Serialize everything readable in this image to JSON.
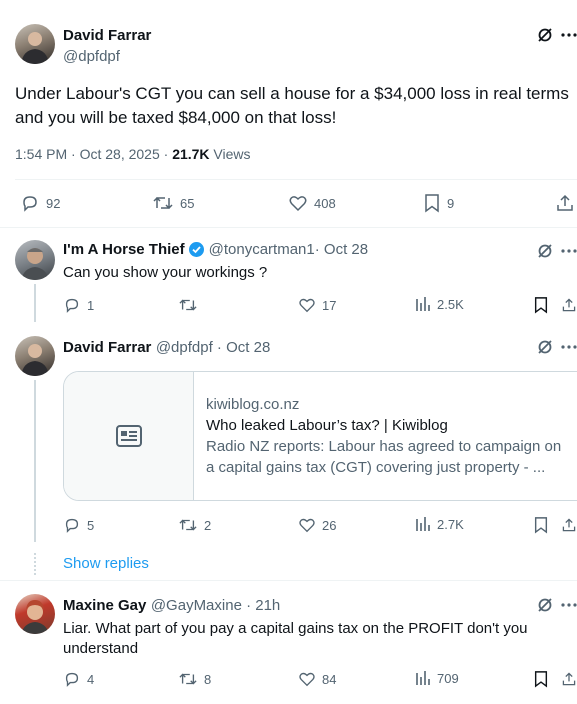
{
  "main_post": {
    "author_name": "David Farrar",
    "author_handle": "@dpfdpf",
    "text_line1": "Under Labour's CGT you can sell a house for a $34,000 loss in real terms",
    "text_line2": "and you will be taxed $84,000 on that loss!",
    "time": "1:54 PM · Oct 28, 2025 · ",
    "views_count": "21.7K",
    "views_label": " Views",
    "replies": "92",
    "reposts": "65",
    "likes": "408",
    "bookmarks": "9"
  },
  "reply1": {
    "author_name": "I'm A Horse Thief",
    "author_handle": "@tonycartman1",
    "date": " · Oct 28",
    "text": "Can you show your workings ?",
    "replies": "1",
    "reposts": "",
    "likes": "17",
    "views": "2.5K"
  },
  "reply2": {
    "author_name": "David Farrar",
    "author_handle": "@dpfdpf",
    "date": " · Oct 28",
    "card": {
      "domain": "kiwiblog.co.nz",
      "title": "Who leaked Labour’s tax? | Kiwiblog",
      "desc_line1": "Radio NZ reports: Labour has agreed to campaign on",
      "desc_line2": "a capital gains tax (CGT) covering just property - ..."
    },
    "replies": "5",
    "reposts": "2",
    "likes": "26",
    "views": "2.7K"
  },
  "show_replies": "Show replies",
  "reply3": {
    "author_name": "Maxine Gay",
    "author_handle": "@GayMaxine",
    "date": " · 21h",
    "text_line1": "Liar. What part of you pay a capital gains tax on the PROFIT don't you",
    "text_line2": "understand",
    "replies": "4",
    "reposts": "8",
    "likes": "84",
    "views": "709"
  },
  "colors": {
    "verified": "#1d9bf0",
    "link": "#1d9bf0",
    "muted": "#536471"
  }
}
